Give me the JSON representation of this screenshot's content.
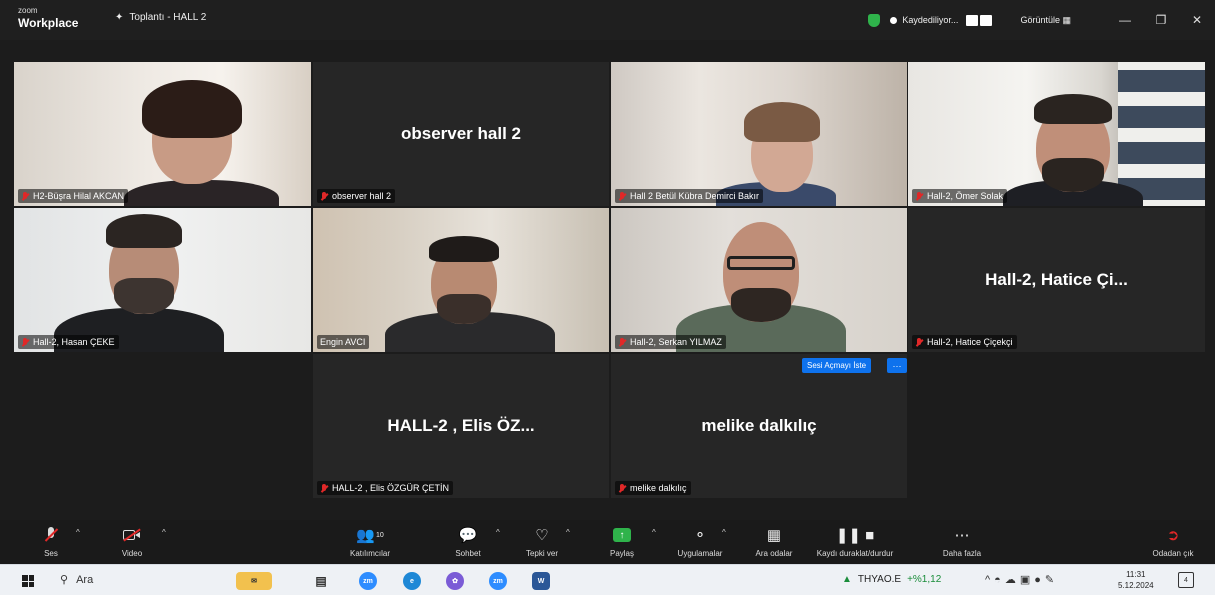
{
  "titlebar": {
    "brand_top": "zoom",
    "brand_bottom": "Workplace",
    "meeting_title": "Toplantı - HALL 2",
    "recording_label": "Kaydediliyor...",
    "view_label": "Görüntüle"
  },
  "tiles": [
    {
      "name": "H2-Büşra Hilal AKCAN",
      "type": "video"
    },
    {
      "name": "observer hall 2",
      "display": "observer hall 2",
      "type": "name"
    },
    {
      "name": "Hall 2 Betül Kübra Demirci Bakır",
      "type": "video"
    },
    {
      "name": "Hall-2, Ömer Solak",
      "type": "video"
    },
    {
      "name": "Hall-2, Hasan ÇEKE",
      "type": "video"
    },
    {
      "name": "Engin AVCI",
      "type": "video",
      "active": true
    },
    {
      "name": "Hall-2, Serkan YILMAZ",
      "type": "video"
    },
    {
      "name": "Hall-2, Hatice Çiçekçi",
      "display": "Hall-2, Hatice Çi...",
      "type": "name"
    },
    {
      "name": "HALL-2 , Elis ÖZGÜR ÇETİN",
      "display": "HALL-2 , Elis ÖZ...",
      "type": "name"
    },
    {
      "name": "melike dalkılıç",
      "display": "melike dalkılıç",
      "type": "name"
    }
  ],
  "unmute_request": {
    "label": "Sesi Açmayı İste",
    "more": "···"
  },
  "toolbar": {
    "audio": "Ses",
    "video": "Video",
    "participants": "Katılımcılar",
    "participants_count": "10",
    "chat": "Sohbet",
    "react": "Tepki ver",
    "share": "Paylaş",
    "apps": "Uygulamalar",
    "rooms": "Ara odalar",
    "record": "Kaydı duraklat/durdur",
    "more": "Daha fazla",
    "leave": "Odadan çık"
  },
  "taskbar": {
    "search": "Ara",
    "stock_name": "THYAO.E",
    "stock_change": "+%1,12",
    "time": "11:31",
    "date": "5.12.2024",
    "notif_count": "4"
  }
}
